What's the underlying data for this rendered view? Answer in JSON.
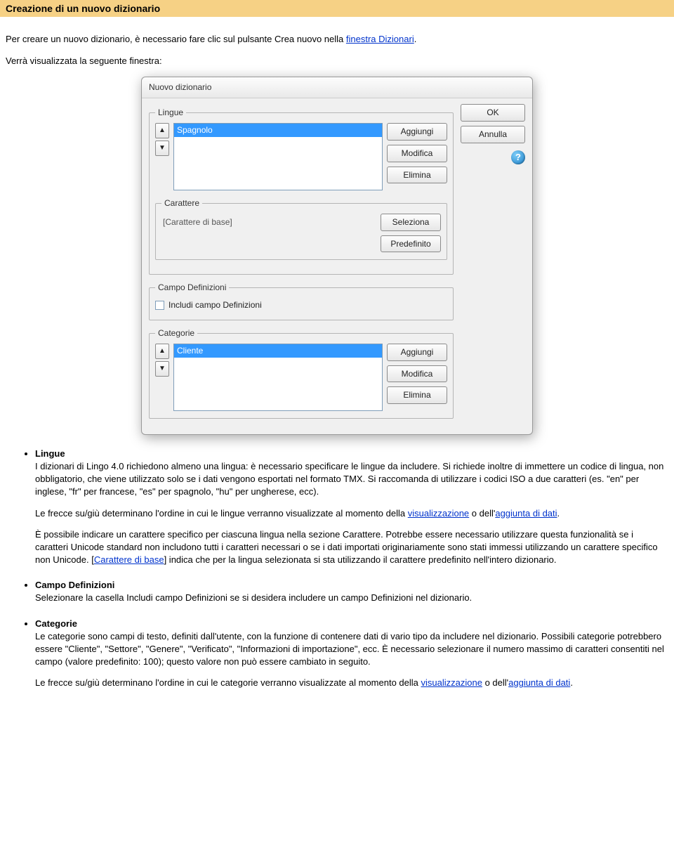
{
  "pageTitle": "Creazione di un nuovo dizionario",
  "intro": {
    "part1": "Per creare un nuovo dizionario, è necessario fare clic sul pulsante Crea nuovo nella ",
    "link1": "finestra Dizionari",
    "part2": ".",
    "line2": "Verrà visualizzata la seguente finestra:"
  },
  "dialog": {
    "title": "Nuovo dizionario",
    "groups": {
      "lingue": {
        "legend": "Lingue",
        "selected": "Spagnolo",
        "aggiungi": "Aggiungi",
        "modifica": "Modifica",
        "elimina": "Elimina",
        "carattere": {
          "legend": "Carattere",
          "value": "[Carattere di base]",
          "seleziona": "Seleziona",
          "predefinito": "Predefinito"
        }
      },
      "definizioni": {
        "legend": "Campo Definizioni",
        "checkbox": "Includi campo Definizioni"
      },
      "categorie": {
        "legend": "Categorie",
        "selected": "Cliente",
        "aggiungi": "Aggiungi",
        "modifica": "Modifica",
        "elimina": "Elimina"
      }
    },
    "side": {
      "ok": "OK",
      "annulla": "Annulla"
    }
  },
  "body": {
    "lingue": {
      "head": "Lingue",
      "p1": "I dizionari di Lingo 4.0 richiedono almeno una lingua: è necessario specificare le lingue da includere. Si richiede inoltre di immettere un codice di lingua, non obbligatorio, che viene utilizzato solo se i dati vengono esportati nel formato TMX. Si raccomanda di utilizzare i codici ISO a due caratteri (es. \"en\" per inglese, \"fr\" per francese, \"es\" per spagnolo, \"hu\" per ungherese, ecc).",
      "p2_a": "Le frecce su/giù determinano l'ordine in cui le lingue verranno visualizzate al momento della ",
      "p2_link1": "visualizzazione",
      "p2_b": " o dell'",
      "p2_link2": "aggiunta di dati",
      "p2_c": ".",
      "p3_a": "È possibile indicare un carattere specifico per ciascuna lingua nella sezione Carattere. Potrebbe essere necessario utilizzare questa funzionalità se i caratteri Unicode standard non includono tutti i caratteri necessari o se i dati importati originariamente sono stati immessi utilizzando un carattere specifico non Unicode. [",
      "p3_link": "Carattere di base",
      "p3_b": "] indica che per la lingua selezionata si sta utilizzando il carattere predefinito nell'intero dizionario."
    },
    "definizioni": {
      "head": "Campo Definizioni",
      "p1": "Selezionare la casella Includi campo Definizioni se si desidera includere un campo Definizioni nel dizionario."
    },
    "categorie": {
      "head": "Categorie",
      "p1": "Le categorie sono campi di testo, definiti dall'utente, con la funzione di contenere dati di vario tipo da includere nel dizionario. Possibili categorie potrebbero essere \"Cliente\", \"Settore\", \"Genere\", \"Verificato\", \"Informazioni di importazione\", ecc. È necessario selezionare il numero massimo di caratteri consentiti nel campo (valore predefinito: 100); questo valore non può essere cambiato in seguito.",
      "p2_a": "Le frecce su/giù determinano l'ordine in cui le categorie verranno visualizzate al momento della ",
      "p2_link1": "visualizzazione",
      "p2_b": " o dell'",
      "p2_link2": "aggiunta di dati",
      "p2_c": "."
    }
  }
}
